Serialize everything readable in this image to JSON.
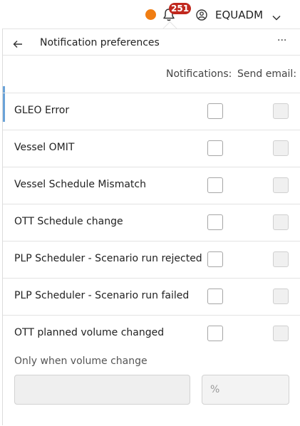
{
  "topbar": {
    "notification_count": "251",
    "username": "EQUADM",
    "status_color": "#f07d12",
    "badge_color": "#c0281e"
  },
  "panel": {
    "title": "Notification preferences",
    "more_label": "···",
    "columns": {
      "notifications": "Notifications:",
      "send_email": "Send email:"
    },
    "rows": [
      {
        "label": "GLEO Error",
        "notify": false,
        "email": false
      },
      {
        "label": "Vessel OMIT",
        "notify": false,
        "email": false
      },
      {
        "label": "Vessel Schedule Mismatch",
        "notify": false,
        "email": false
      },
      {
        "label": "OTT Schedule change",
        "notify": false,
        "email": false
      },
      {
        "label": "PLP Scheduler - Scenario run rejected",
        "notify": false,
        "email": false
      },
      {
        "label": "PLP Scheduler - Scenario run failed",
        "notify": false,
        "email": false
      },
      {
        "label": "OTT planned volume changed",
        "notify": false,
        "email": false
      }
    ],
    "volume_condition_label": "Only when volume change",
    "volume_value": "",
    "percent_placeholder": "%"
  }
}
